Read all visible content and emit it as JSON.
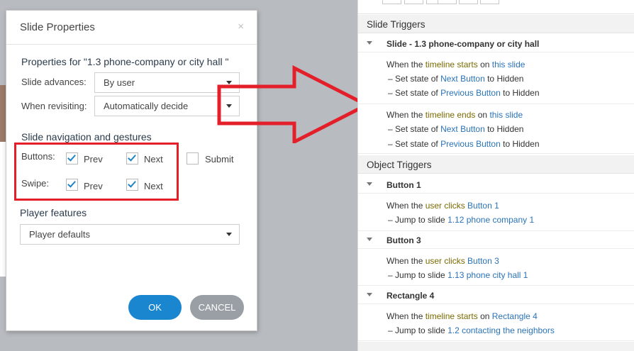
{
  "dialog": {
    "title": "Slide Properties",
    "close_glyph": "×",
    "properties_for": "Properties for \"1.3 phone-company or city hall \"",
    "slide_advances_label": "Slide advances:",
    "slide_advances_value": "By user",
    "when_revisiting_label": "When revisiting:",
    "when_revisiting_value": "Automatically decide",
    "nav_section_title": "Slide navigation and gestures",
    "buttons_label": "Buttons:",
    "swipe_label": "Swipe:",
    "prev_label": "Prev",
    "next_label": "Next",
    "submit_label": "Submit",
    "checkboxes": {
      "buttons_prev": true,
      "buttons_next": true,
      "submit": false,
      "swipe_prev": true,
      "swipe_next": true
    },
    "player_features_title": "Player features",
    "player_features_value": "Player defaults",
    "ok_label": "OK",
    "cancel_label": "CANCEL"
  },
  "triggers": {
    "slide_triggers_title": "Slide Triggers",
    "slide_group_title": "Slide - 1.3 phone-company or city hall",
    "block1": {
      "when": "When the ",
      "event": "timeline starts",
      "on": " on ",
      "target": "this slide",
      "actions": [
        {
          "prefix": "Set state of ",
          "object": "Next Button",
          "to": " to ",
          "state": "Hidden"
        },
        {
          "prefix": "Set state of ",
          "object": "Previous Button",
          "to": " to ",
          "state": "Hidden"
        }
      ]
    },
    "block2": {
      "when": "When the ",
      "event": "timeline ends",
      "on": " on ",
      "target": "this slide",
      "actions": [
        {
          "prefix": "Set state of ",
          "object": "Next Button",
          "to": " to ",
          "state": "Hidden"
        },
        {
          "prefix": "Set state of ",
          "object": "Previous Button",
          "to": " to ",
          "state": "Hidden"
        }
      ]
    },
    "object_triggers_title": "Object Triggers",
    "objects": [
      {
        "name": "Button 1",
        "when": "When the ",
        "event": "user clicks",
        "target": " Button 1",
        "jump": "Jump to slide ",
        "slide": "1.12 phone company 1"
      },
      {
        "name": "Button 3",
        "when": "When the ",
        "event": "user clicks",
        "target": " Button 3",
        "jump": "Jump to slide ",
        "slide": "1.13 phone city hall 1"
      },
      {
        "name": "Rectangle 4",
        "when": "When the ",
        "event": "timeline starts",
        "on": " on ",
        "target": "Rectangle 4",
        "jump": "Jump to slide ",
        "slide": "1.2 contacting the neighbors"
      }
    ]
  },
  "colors": {
    "accent": "#1b86d0",
    "highlight_red": "#e3202a",
    "link": "#2a73b8"
  }
}
